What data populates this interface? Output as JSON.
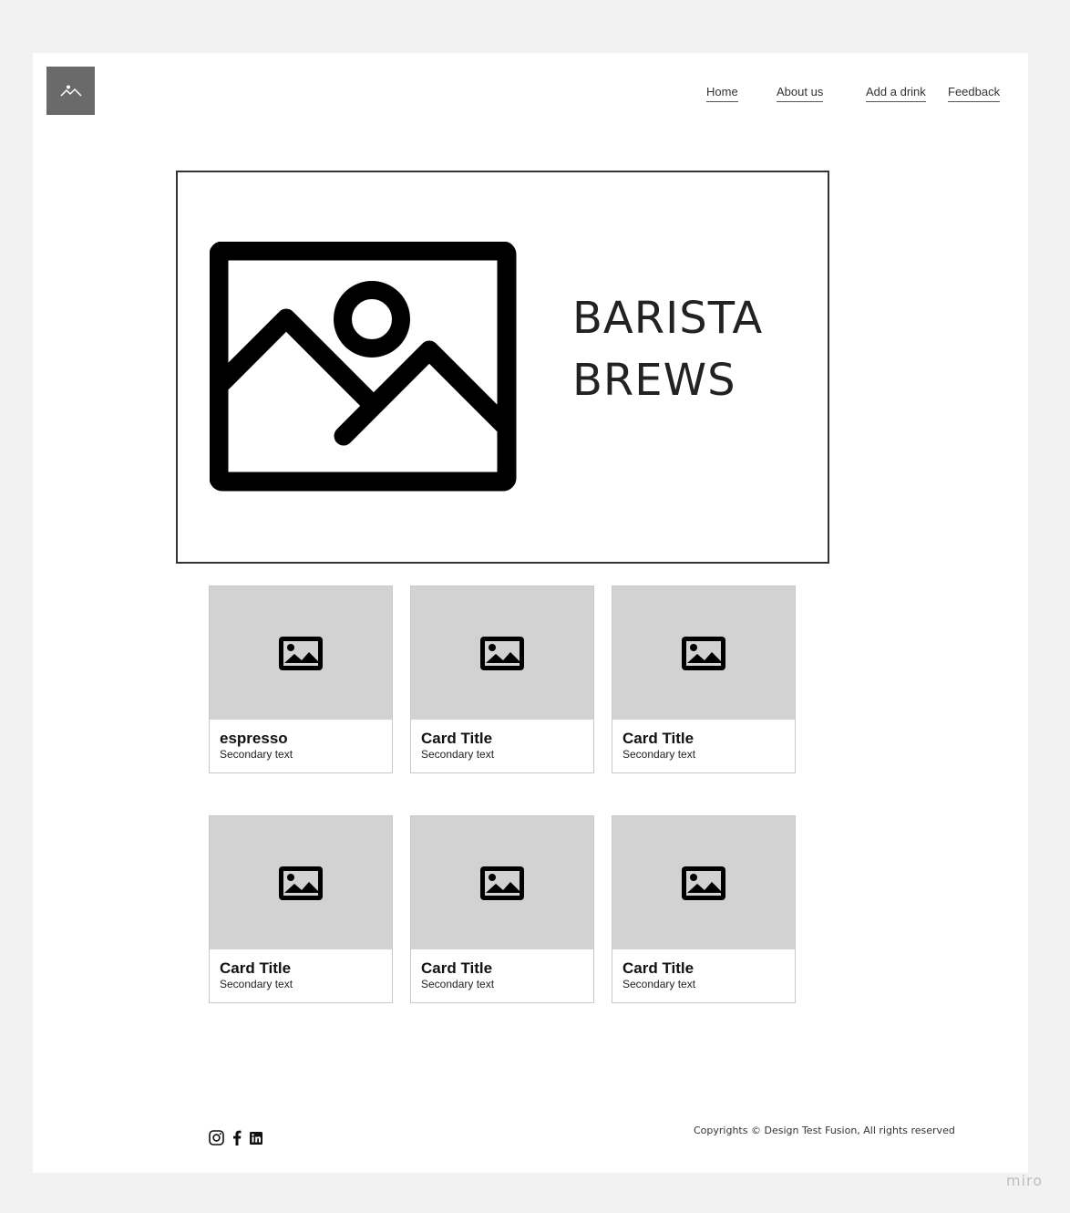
{
  "nav": {
    "items": [
      {
        "label": "Home"
      },
      {
        "label": "About us"
      },
      {
        "label": "Add a drink"
      },
      {
        "label": "Feedback"
      }
    ]
  },
  "hero": {
    "title_line1": "BARISTA",
    "title_line2": "BREWS"
  },
  "cards": [
    {
      "title": "espresso",
      "subtitle": "Secondary text"
    },
    {
      "title": "Card Title",
      "subtitle": "Secondary text"
    },
    {
      "title": "Card Title",
      "subtitle": "Secondary text"
    },
    {
      "title": "Card Title",
      "subtitle": "Secondary text"
    },
    {
      "title": "Card Title",
      "subtitle": "Secondary text"
    },
    {
      "title": "Card Title",
      "subtitle": "Secondary text"
    }
  ],
  "footer": {
    "social": [
      "instagram-icon",
      "facebook-icon",
      "linkedin-icon"
    ],
    "copyright": "Copyrights © Design Test Fusion, All rights reserved"
  },
  "watermark": "miro"
}
